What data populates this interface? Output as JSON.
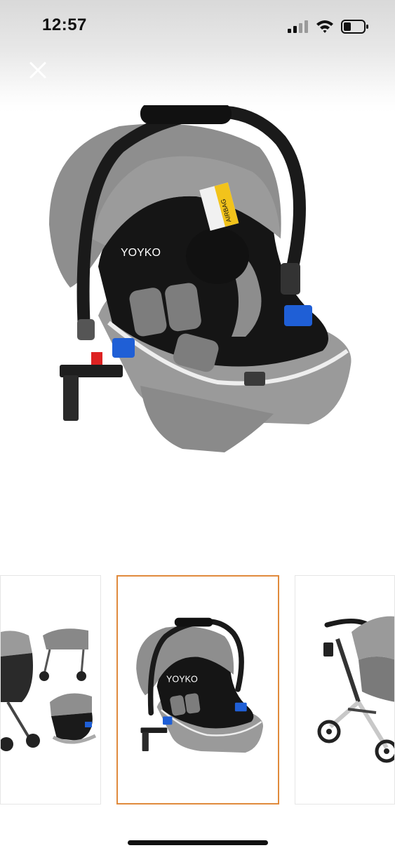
{
  "status_bar": {
    "time": "12:57",
    "icons": [
      "cellular-signal-icon",
      "wifi-icon",
      "battery-icon"
    ]
  },
  "viewer": {
    "close_icon": "close-icon",
    "main_image": {
      "subject": "car-seat",
      "brand_text": "YOYKO",
      "label_text": "AIRBAG"
    }
  },
  "thumbnails": [
    {
      "subject": "stroller-set",
      "selected": false
    },
    {
      "subject": "car-seat",
      "selected": true,
      "brand_text": "YOYKO"
    },
    {
      "subject": "stroller",
      "selected": false
    }
  ],
  "colors": {
    "selected_border": "#e08a3c",
    "canopy_gray": "#8e8e8e",
    "accent_blue": "#1f5fd6"
  }
}
